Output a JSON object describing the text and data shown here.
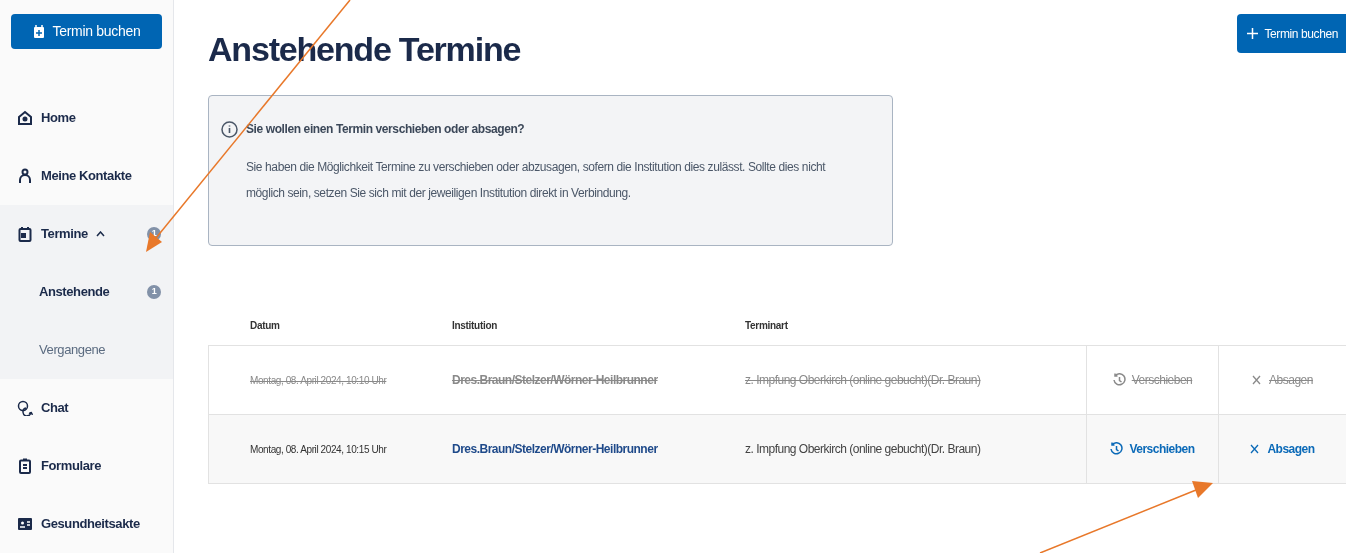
{
  "sidebar": {
    "book_button": "Termin buchen",
    "items": [
      {
        "kind": "home",
        "label": "Home",
        "selected": false
      },
      {
        "kind": "contacts",
        "label": "Meine Kontakte",
        "selected": false
      },
      {
        "kind": "calendar",
        "label": "Termine",
        "selected": false,
        "expanded": true,
        "badge": "1",
        "children": [
          {
            "label": "Anstehende",
            "selected": true,
            "badge": "1"
          },
          {
            "label": "Vergangene",
            "selected": false
          }
        ]
      },
      {
        "kind": "chat",
        "label": "Chat",
        "selected": false
      },
      {
        "kind": "clipboard",
        "label": "Formulare",
        "selected": false
      },
      {
        "kind": "record",
        "label": "Gesundheitsakte",
        "selected": false
      }
    ]
  },
  "page": {
    "title": "Anstehende Termine",
    "book_button": "Termin buchen"
  },
  "info": {
    "title": "Sie wollen einen Termin verschieben oder absagen?",
    "text": "Sie haben die Möglichkeit Termine zu verschieben oder abzusagen, sofern die Institution dies zulässt. Sollte dies nicht möglich sein, setzen Sie sich mit der jeweiligen Institution direkt in Verbindung."
  },
  "table": {
    "columns": [
      "Datum",
      "Institution",
      "Terminart"
    ],
    "rows": [
      {
        "date": "Montag, 08. April 2024, 10:10 Uhr",
        "institution": "Dres.Braun/Stelzer/Wörner-Heilbrunner",
        "type": "z. Impfung Oberkirch (online gebucht)(Dr. Braun)",
        "reschedule": "Verschieben",
        "cancel": "Absagen",
        "cancelled": true
      },
      {
        "date": "Montag, 08. April 2024, 10:15 Uhr",
        "institution": "Dres.Braun/Stelzer/Wörner-Heilbrunner",
        "type": "z. Impfung Oberkirch (online gebucht)(Dr. Braun)",
        "reschedule": "Verschieben",
        "cancel": "Absagen",
        "cancelled": false
      }
    ]
  }
}
